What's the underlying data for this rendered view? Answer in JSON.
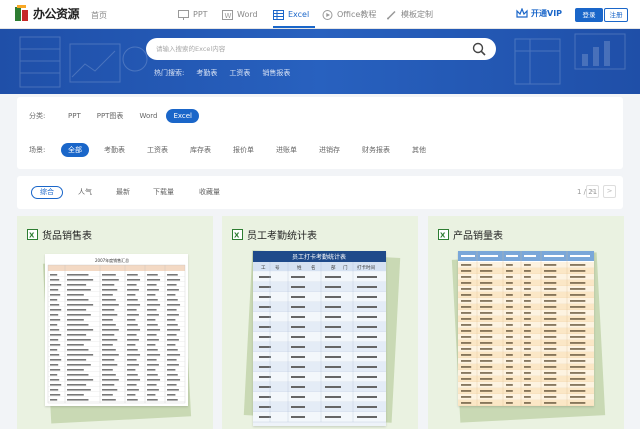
{
  "nav": {
    "logo_text": "办公资源",
    "home": "首页",
    "items": [
      {
        "label": "PPT",
        "icon": "presentation-icon"
      },
      {
        "label": "Word",
        "icon": "word-icon"
      },
      {
        "label": "Excel",
        "icon": "excel-icon",
        "active": true
      },
      {
        "label": "Office教程",
        "icon": "play-circle-icon"
      },
      {
        "label": "模板定制",
        "icon": "pen-icon"
      }
    ],
    "vip_label": "开通VIP",
    "login_label": "登录",
    "register_label": "注册",
    "accent_color": "#1a66c9"
  },
  "search": {
    "placeholder": "请输入搜索的Excel内容",
    "hot_label": "热门搜索:",
    "hot_terms": [
      "考勤表",
      "工资表",
      "销售报表"
    ]
  },
  "filters": {
    "category_label": "分类:",
    "categories": [
      "PPT",
      "PPT图表",
      "Word",
      "Excel"
    ],
    "active_category": "Excel",
    "scene_label": "场景:",
    "scenes": [
      "全部",
      "考勤表",
      "工资表",
      "库存表",
      "报价单",
      "进账单",
      "进销存",
      "财务报表",
      "其他"
    ],
    "active_scene": "全部"
  },
  "sort": {
    "options": [
      "综合",
      "人气",
      "最新",
      "下载量",
      "收藏量"
    ],
    "active": "综合",
    "page_indicator": "1 / 21",
    "prev": "<",
    "next": ">"
  },
  "cards": [
    {
      "title": "货品销售表",
      "sheet_caption": "2007年度销售汇总"
    },
    {
      "title": "员工考勤统计表",
      "sheet_caption": "员工打卡考勤统计表",
      "columns": [
        "工",
        "号",
        "姓",
        "名",
        "部",
        "门",
        "打卡时间"
      ]
    },
    {
      "title": "产品销量表"
    }
  ]
}
